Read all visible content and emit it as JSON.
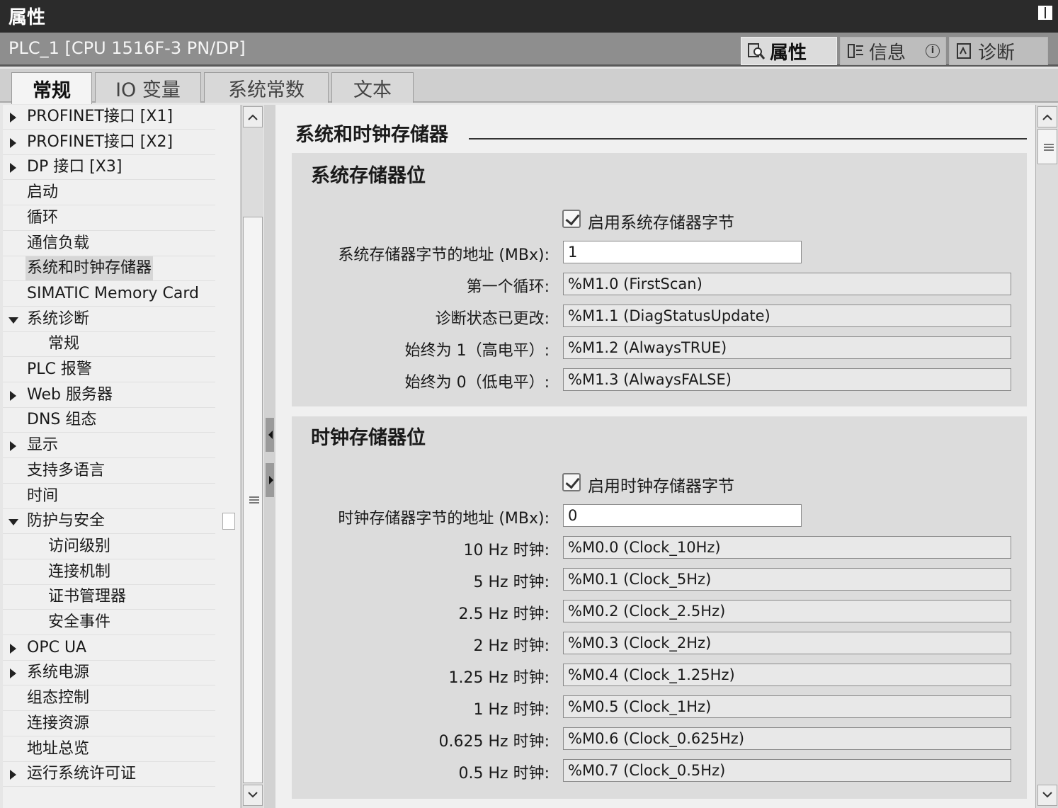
{
  "window": {
    "title": "属性"
  },
  "header": {
    "device": "PLC_1 [CPU 1516F-3 PN/DP]",
    "inspector_tabs": [
      {
        "label": "属性",
        "icon": "properties-icon",
        "active": true
      },
      {
        "label": "信息",
        "icon": "info-icon",
        "active": false
      },
      {
        "label": "诊断",
        "icon": "diagnostics-icon",
        "active": false
      }
    ]
  },
  "tabs": [
    {
      "label": "常规",
      "active": true
    },
    {
      "label": "IO 变量",
      "active": false
    },
    {
      "label": "系统常数",
      "active": false
    },
    {
      "label": "文本",
      "active": false
    }
  ],
  "nav_tree": [
    {
      "label": "PROFINET接口 [X1]",
      "level": 0,
      "arrow": "right"
    },
    {
      "label": "PROFINET接口 [X2]",
      "level": 0,
      "arrow": "right"
    },
    {
      "label": "DP 接口 [X3]",
      "level": 0,
      "arrow": "right"
    },
    {
      "label": "启动",
      "level": 0,
      "arrow": ""
    },
    {
      "label": "循环",
      "level": 0,
      "arrow": ""
    },
    {
      "label": "通信负载",
      "level": 0,
      "arrow": ""
    },
    {
      "label": "系统和时钟存储器",
      "level": 0,
      "arrow": "",
      "selected": true
    },
    {
      "label": "SIMATIC Memory Card",
      "level": 0,
      "arrow": ""
    },
    {
      "label": "系统诊断",
      "level": 0,
      "arrow": "down"
    },
    {
      "label": "常规",
      "level": 1,
      "arrow": ""
    },
    {
      "label": "PLC 报警",
      "level": 0,
      "arrow": ""
    },
    {
      "label": "Web 服务器",
      "level": 0,
      "arrow": "right"
    },
    {
      "label": "DNS 组态",
      "level": 0,
      "arrow": ""
    },
    {
      "label": "显示",
      "level": 0,
      "arrow": "right"
    },
    {
      "label": "支持多语言",
      "level": 0,
      "arrow": ""
    },
    {
      "label": "时间",
      "level": 0,
      "arrow": ""
    },
    {
      "label": "防护与安全",
      "level": 0,
      "arrow": "down"
    },
    {
      "label": "访问级别",
      "level": 1,
      "arrow": ""
    },
    {
      "label": "连接机制",
      "level": 1,
      "arrow": ""
    },
    {
      "label": "证书管理器",
      "level": 1,
      "arrow": ""
    },
    {
      "label": "安全事件",
      "level": 1,
      "arrow": ""
    },
    {
      "label": "OPC UA",
      "level": 0,
      "arrow": "right"
    },
    {
      "label": "系统电源",
      "level": 0,
      "arrow": "right"
    },
    {
      "label": "组态控制",
      "level": 0,
      "arrow": ""
    },
    {
      "label": "连接资源",
      "level": 0,
      "arrow": ""
    },
    {
      "label": "地址总览",
      "level": 0,
      "arrow": ""
    },
    {
      "label": "运行系统许可证",
      "level": 0,
      "arrow": "right"
    }
  ],
  "content": {
    "section_title": "系统和时钟存储器",
    "system_memory": {
      "title": "系统存储器位",
      "enable_label": "启用系统存储器字节",
      "enabled": true,
      "address_label": "系统存储器字节的地址 (MBx):",
      "address_value": "1",
      "bits": [
        {
          "label": "第一个循环:",
          "value": "%M1.0 (FirstScan)"
        },
        {
          "label": "诊断状态已更改:",
          "value": "%M1.1 (DiagStatusUpdate)"
        },
        {
          "label": "始终为 1（高电平）:",
          "value": "%M1.2 (AlwaysTRUE)"
        },
        {
          "label": "始终为 0（低电平）:",
          "value": "%M1.3 (AlwaysFALSE)"
        }
      ]
    },
    "clock_memory": {
      "title": "时钟存储器位",
      "enable_label": "启用时钟存储器字节",
      "enabled": true,
      "address_label": "时钟存储器字节的地址 (MBx):",
      "address_value": "0",
      "bits": [
        {
          "label": "10 Hz 时钟:",
          "value": "%M0.0 (Clock_10Hz)"
        },
        {
          "label": "5 Hz 时钟:",
          "value": "%M0.1 (Clock_5Hz)"
        },
        {
          "label": "2.5 Hz 时钟:",
          "value": "%M0.2 (Clock_2.5Hz)"
        },
        {
          "label": "2 Hz 时钟:",
          "value": "%M0.3 (Clock_2Hz)"
        },
        {
          "label": "1.25 Hz 时钟:",
          "value": "%M0.4 (Clock_1.25Hz)"
        },
        {
          "label": "1 Hz 时钟:",
          "value": "%M0.5 (Clock_1Hz)"
        },
        {
          "label": "0.625 Hz 时钟:",
          "value": "%M0.6 (Clock_0.625Hz)"
        },
        {
          "label": "0.5 Hz 时钟:",
          "value": "%M0.7 (Clock_0.5Hz)"
        }
      ]
    }
  },
  "colors": {
    "titlebar": "#2b2b2b",
    "header": "#8e8e8e",
    "panel": "#dcdcdc",
    "selection": "#d6d6d6"
  }
}
